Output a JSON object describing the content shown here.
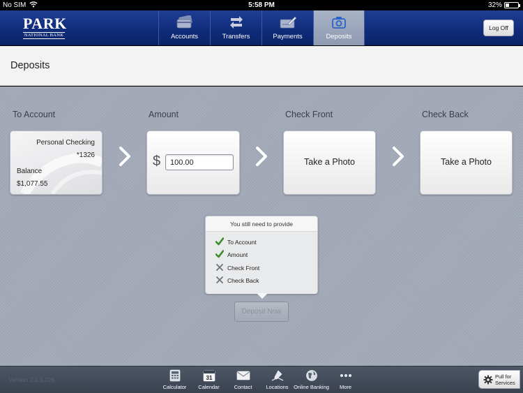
{
  "status_bar": {
    "carrier": "No SIM",
    "time": "5:58 PM",
    "battery_percent": "32%",
    "battery_level": 0.32
  },
  "header": {
    "logo": {
      "name": "PARK",
      "sub": "NATIONAL BANK"
    },
    "tabs": [
      {
        "label": "Accounts",
        "icon": "cards-icon",
        "active": false
      },
      {
        "label": "Transfers",
        "icon": "transfer-arrows-icon",
        "active": false
      },
      {
        "label": "Payments",
        "icon": "checkbook-pen-icon",
        "active": false
      },
      {
        "label": "Deposits",
        "icon": "camera-icon",
        "active": true
      }
    ],
    "logoff_label": "Log Off"
  },
  "page_title": "Deposits",
  "steps": {
    "to_account": {
      "label": "To Account",
      "account_name": "Personal Checking",
      "account_number": "*1326",
      "balance_label": "Balance",
      "balance": "$1,077.55"
    },
    "amount": {
      "label": "Amount",
      "currency": "$",
      "value": "100.00"
    },
    "check_front": {
      "label": "Check Front",
      "action": "Take a Photo"
    },
    "check_back": {
      "label": "Check Back",
      "action": "Take a Photo"
    }
  },
  "requirements": {
    "title": "You still need to provide",
    "items": [
      {
        "label": "To Account",
        "done": true
      },
      {
        "label": "Amount",
        "done": true
      },
      {
        "label": "Check Front",
        "done": false
      },
      {
        "label": "Check Back",
        "done": false
      }
    ]
  },
  "deposit_button": "Deposit Now",
  "footer": {
    "version": "Version 2.0.0.226",
    "items": [
      {
        "label": "Calculator",
        "icon": "calculator-icon"
      },
      {
        "label": "Calendar",
        "icon": "calendar-icon",
        "day": "31"
      },
      {
        "label": "Contact",
        "icon": "envelope-icon"
      },
      {
        "label": "Locations",
        "icon": "locations-icon"
      },
      {
        "label": "Online Banking",
        "icon": "globe-icon"
      },
      {
        "label": "More",
        "icon": "more-dots-icon"
      }
    ],
    "pull_line1": "Pull for",
    "pull_line2": "Services"
  },
  "colors": {
    "nav_blue": "#0f2b7a",
    "check_green": "#3c8c2a",
    "content_bg": "#a3aab8"
  }
}
